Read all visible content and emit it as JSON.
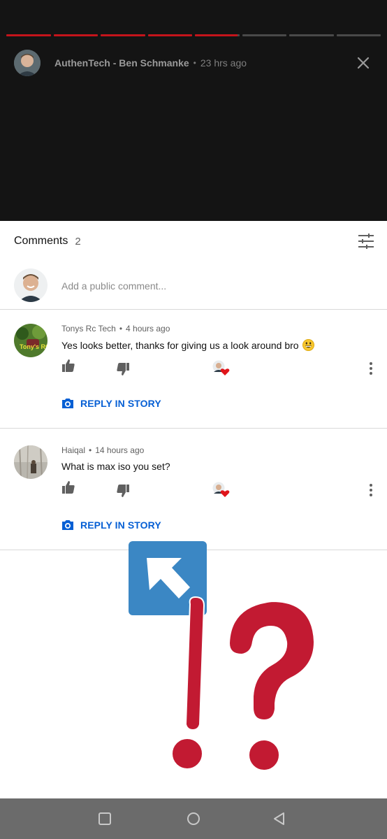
{
  "story": {
    "channel_name": "AuthenTech - Ben Schmanke",
    "separator": "•",
    "time_ago": "23 hrs ago",
    "progress_segments": [
      "played",
      "played",
      "played",
      "played",
      "active",
      "pending",
      "pending",
      "pending"
    ],
    "colors": {
      "played": "#c4141b",
      "pending": "#4a4a4a",
      "background": "#141414"
    }
  },
  "comments_panel": {
    "title": "Comments",
    "count": "2",
    "compose_placeholder": "Add a public comment..."
  },
  "comments": [
    {
      "author": "Tonys Rc Tech",
      "separator": "•",
      "time_ago": "4 hours ago",
      "text": "Yes looks better, thanks for giving us a look around bro",
      "emoji": "grinning-face",
      "reply_label": "REPLY IN STORY",
      "avatar_text": "Tony's RC"
    },
    {
      "author": "Haiqal",
      "separator": "•",
      "time_ago": "14 hours ago",
      "text": "What is max iso you set?",
      "reply_label": "REPLY IN STORY"
    }
  ],
  "accent_colors": {
    "link_blue": "#065fd4",
    "heart_red": "#e0151b",
    "annotation_red": "#c21a32",
    "annotation_blue": "#3b87c4"
  },
  "navigation": {
    "buttons": [
      "recents-icon",
      "home-icon",
      "back-icon"
    ]
  }
}
